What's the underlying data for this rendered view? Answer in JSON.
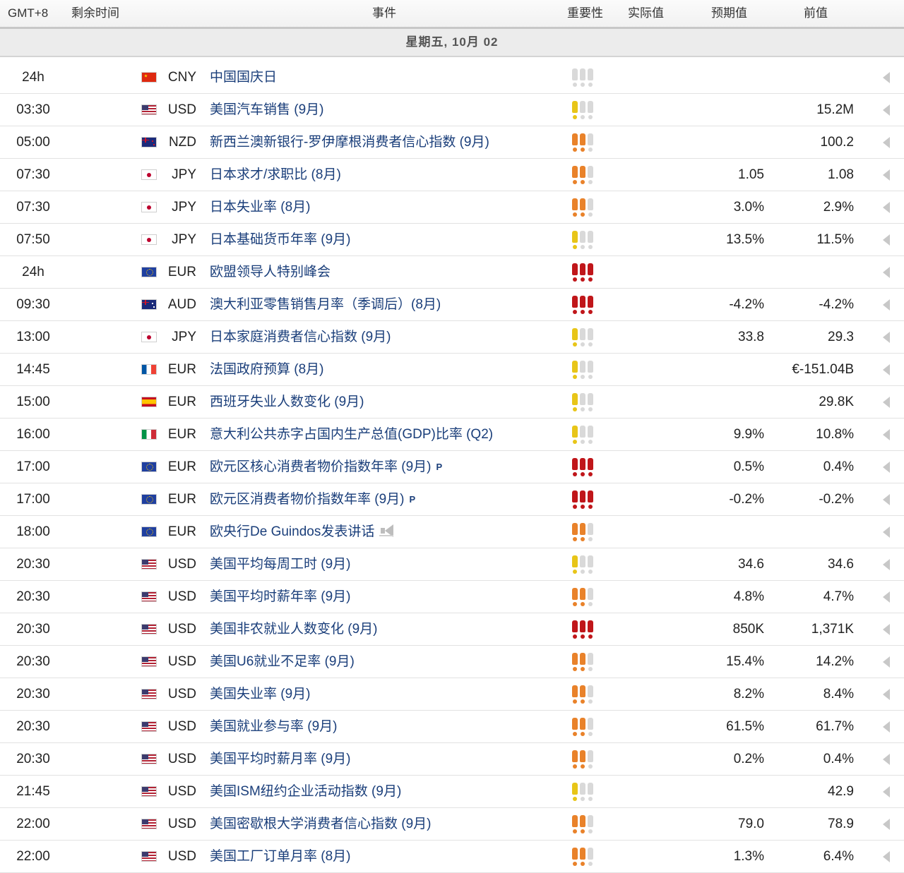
{
  "header": {
    "timezone": "GMT+8",
    "remaining": "剩余时间",
    "event": "事件",
    "importance": "重要性",
    "actual": "实际值",
    "forecast": "预期值",
    "previous": "前值"
  },
  "date_label": "星期五, 10月 02",
  "colors": {
    "yellow": "#e8c518",
    "orange": "#e9822a",
    "red": "#c0161a",
    "inactive": "#d9d9d9",
    "event_text": "#1a3e7a"
  },
  "rows": [
    {
      "time": "24h",
      "flag": "cn",
      "currency": "CNY",
      "event": "中国国庆日",
      "importance": 0,
      "importance_color": "none",
      "forecast": "",
      "previous": "",
      "badge": ""
    },
    {
      "time": "03:30",
      "flag": "us",
      "currency": "USD",
      "event": "美国汽车销售 (9月)",
      "importance": 1,
      "importance_color": "yellow",
      "forecast": "",
      "previous": "15.2M",
      "badge": ""
    },
    {
      "time": "05:00",
      "flag": "nz",
      "currency": "NZD",
      "event": "新西兰澳新银行-罗伊摩根消费者信心指数 (9月)",
      "importance": 2,
      "importance_color": "orange",
      "forecast": "",
      "previous": "100.2",
      "badge": ""
    },
    {
      "time": "07:30",
      "flag": "jp",
      "currency": "JPY",
      "event": "日本求才/求职比 (8月)",
      "importance": 2,
      "importance_color": "orange",
      "forecast": "1.05",
      "previous": "1.08",
      "badge": ""
    },
    {
      "time": "07:30",
      "flag": "jp",
      "currency": "JPY",
      "event": "日本失业率 (8月)",
      "importance": 2,
      "importance_color": "orange",
      "forecast": "3.0%",
      "previous": "2.9%",
      "badge": ""
    },
    {
      "time": "07:50",
      "flag": "jp",
      "currency": "JPY",
      "event": "日本基础货币年率 (9月)",
      "importance": 1,
      "importance_color": "yellow",
      "forecast": "13.5%",
      "previous": "11.5%",
      "badge": ""
    },
    {
      "time": "24h",
      "flag": "eu",
      "currency": "EUR",
      "event": "欧盟领导人特别峰会",
      "importance": 3,
      "importance_color": "red",
      "forecast": "",
      "previous": "",
      "badge": ""
    },
    {
      "time": "09:30",
      "flag": "au",
      "currency": "AUD",
      "event": "澳大利亚零售销售月率（季调后）(8月)",
      "importance": 3,
      "importance_color": "red",
      "forecast": "-4.2%",
      "previous": "-4.2%",
      "badge": ""
    },
    {
      "time": "13:00",
      "flag": "jp",
      "currency": "JPY",
      "event": "日本家庭消费者信心指数 (9月)",
      "importance": 1,
      "importance_color": "yellow",
      "forecast": "33.8",
      "previous": "29.3",
      "badge": ""
    },
    {
      "time": "14:45",
      "flag": "fr",
      "currency": "EUR",
      "event": "法国政府预算 (8月)",
      "importance": 1,
      "importance_color": "yellow",
      "forecast": "",
      "previous": "€-151.04B",
      "badge": ""
    },
    {
      "time": "15:00",
      "flag": "es",
      "currency": "EUR",
      "event": "西班牙失业人数变化 (9月)",
      "importance": 1,
      "importance_color": "yellow",
      "forecast": "",
      "previous": "29.8K",
      "badge": ""
    },
    {
      "time": "16:00",
      "flag": "it",
      "currency": "EUR",
      "event": "意大利公共赤字占国内生产总值(GDP)比率 (Q2)",
      "importance": 1,
      "importance_color": "yellow",
      "forecast": "9.9%",
      "previous": "10.8%",
      "badge": ""
    },
    {
      "time": "17:00",
      "flag": "eu",
      "currency": "EUR",
      "event": "欧元区核心消费者物价指数年率 (9月)",
      "importance": 3,
      "importance_color": "red",
      "forecast": "0.5%",
      "previous": "0.4%",
      "badge": "P"
    },
    {
      "time": "17:00",
      "flag": "eu",
      "currency": "EUR",
      "event": "欧元区消费者物价指数年率 (9月)",
      "importance": 3,
      "importance_color": "red",
      "forecast": "-0.2%",
      "previous": "-0.2%",
      "badge": "P"
    },
    {
      "time": "18:00",
      "flag": "eu",
      "currency": "EUR",
      "event": "欧央行De Guindos发表讲话",
      "importance": 2,
      "importance_color": "orange",
      "forecast": "",
      "previous": "",
      "badge": "speech"
    },
    {
      "time": "20:30",
      "flag": "us",
      "currency": "USD",
      "event": "美国平均每周工时 (9月)",
      "importance": 1,
      "importance_color": "yellow",
      "forecast": "34.6",
      "previous": "34.6",
      "badge": ""
    },
    {
      "time": "20:30",
      "flag": "us",
      "currency": "USD",
      "event": "美国平均时薪年率 (9月)",
      "importance": 2,
      "importance_color": "orange",
      "forecast": "4.8%",
      "previous": "4.7%",
      "badge": ""
    },
    {
      "time": "20:30",
      "flag": "us",
      "currency": "USD",
      "event": "美国非农就业人数变化 (9月)",
      "importance": 3,
      "importance_color": "red",
      "forecast": "850K",
      "previous": "1,371K",
      "badge": ""
    },
    {
      "time": "20:30",
      "flag": "us",
      "currency": "USD",
      "event": "美国U6就业不足率 (9月)",
      "importance": 2,
      "importance_color": "orange",
      "forecast": "15.4%",
      "previous": "14.2%",
      "badge": ""
    },
    {
      "time": "20:30",
      "flag": "us",
      "currency": "USD",
      "event": "美国失业率 (9月)",
      "importance": 2,
      "importance_color": "orange",
      "forecast": "8.2%",
      "previous": "8.4%",
      "badge": ""
    },
    {
      "time": "20:30",
      "flag": "us",
      "currency": "USD",
      "event": "美国就业参与率 (9月)",
      "importance": 2,
      "importance_color": "orange",
      "forecast": "61.5%",
      "previous": "61.7%",
      "badge": ""
    },
    {
      "time": "20:30",
      "flag": "us",
      "currency": "USD",
      "event": "美国平均时薪月率 (9月)",
      "importance": 2,
      "importance_color": "orange",
      "forecast": "0.2%",
      "previous": "0.4%",
      "badge": ""
    },
    {
      "time": "21:45",
      "flag": "us",
      "currency": "USD",
      "event": "美国ISM纽约企业活动指数 (9月)",
      "importance": 1,
      "importance_color": "yellow",
      "forecast": "",
      "previous": "42.9",
      "badge": ""
    },
    {
      "time": "22:00",
      "flag": "us",
      "currency": "USD",
      "event": "美国密歇根大学消费者信心指数 (9月)",
      "importance": 2,
      "importance_color": "orange",
      "forecast": "79.0",
      "previous": "78.9",
      "badge": ""
    },
    {
      "time": "22:00",
      "flag": "us",
      "currency": "USD",
      "event": "美国工厂订单月率 (8月)",
      "importance": 2,
      "importance_color": "orange",
      "forecast": "1.3%",
      "previous": "6.4%",
      "badge": ""
    }
  ]
}
